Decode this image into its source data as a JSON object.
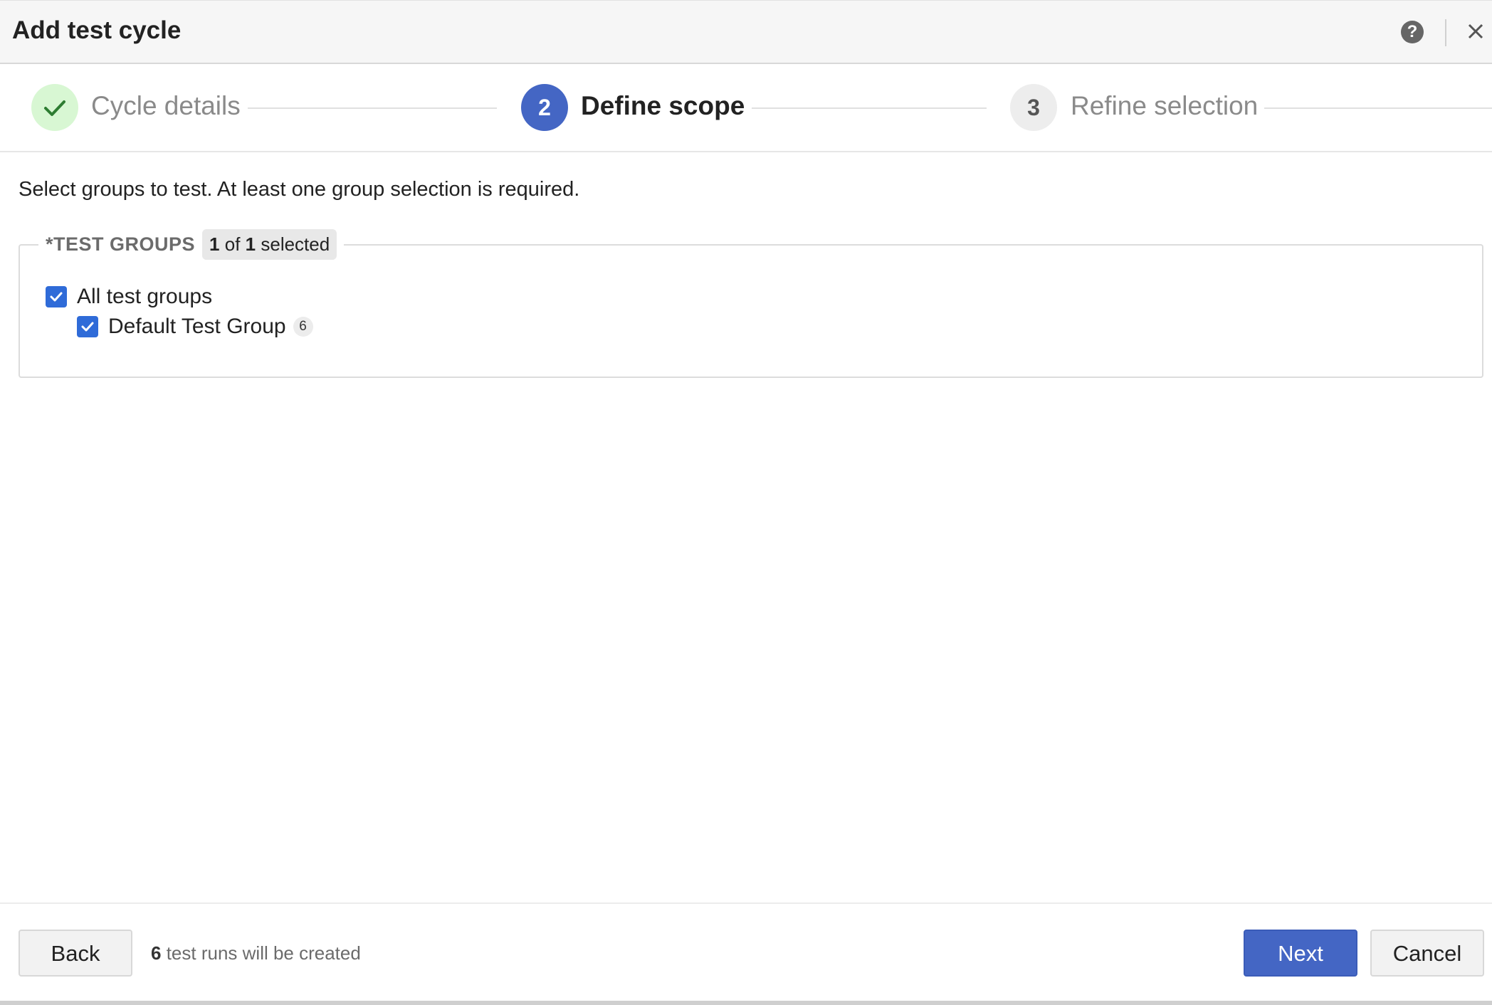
{
  "dialog": {
    "title": "Add test cycle",
    "help_icon": "question-circle-icon",
    "close_icon": "close-icon"
  },
  "stepper": {
    "steps": [
      {
        "number": "",
        "label": "Cycle details",
        "state": "completed",
        "icon": "checkmark-icon"
      },
      {
        "number": "2",
        "label": "Define scope",
        "state": "active"
      },
      {
        "number": "3",
        "label": "Refine selection",
        "state": "upcoming"
      }
    ]
  },
  "body": {
    "instruction": "Select groups to test. At least one group selection is required.",
    "test_groups": {
      "label": "*TEST GROUPS",
      "selected_count": "1",
      "of_text": "of",
      "total_count": "1",
      "selected_text": "selected",
      "items": [
        {
          "label": "All test groups",
          "checked": true
        },
        {
          "label": "Default Test Group",
          "checked": true,
          "count": "6"
        }
      ]
    }
  },
  "footer": {
    "back_label": "Back",
    "runs_count": "6",
    "runs_text": "test runs will be created",
    "next_label": "Next",
    "cancel_label": "Cancel"
  },
  "colors": {
    "primary": "#4466c4",
    "checkbox": "#2f6bd8",
    "completed_step_bg": "#d8f7d3",
    "completed_check": "#2e7d32"
  }
}
